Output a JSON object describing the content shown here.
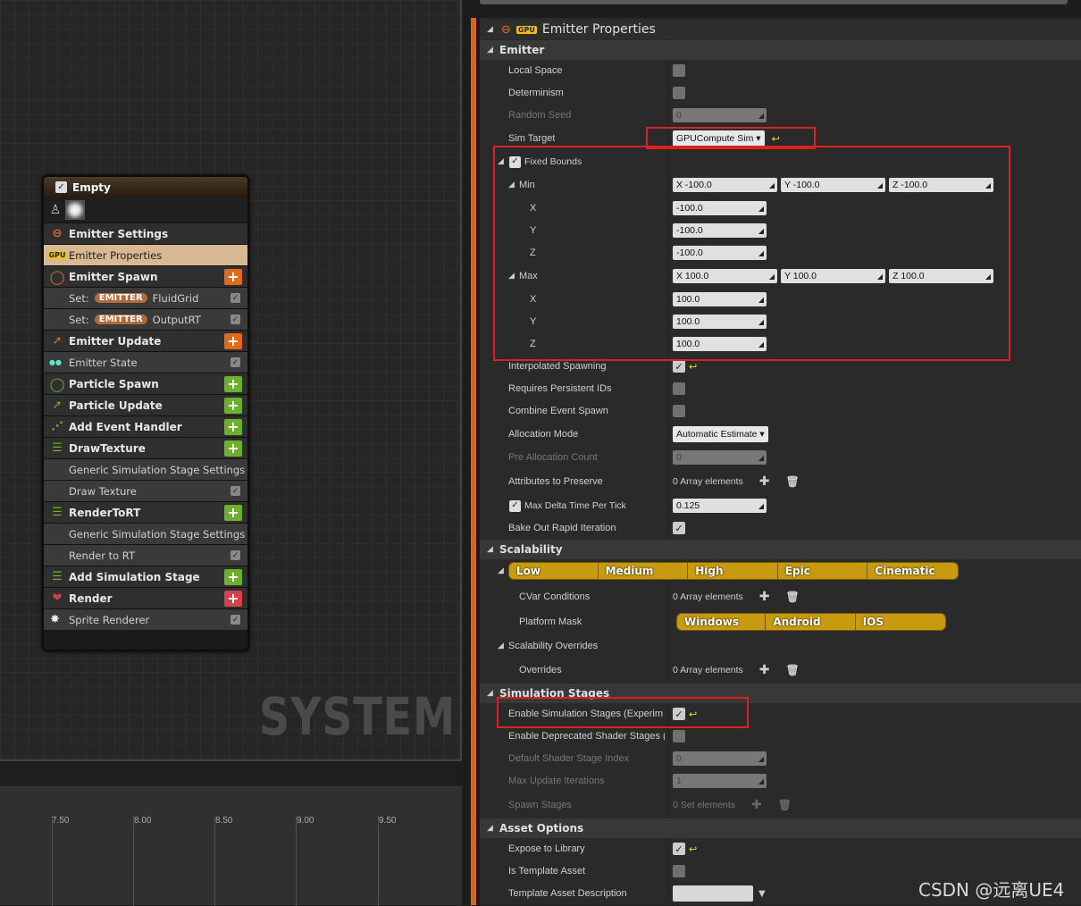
{
  "graph": {
    "watermark": "SYSTEM",
    "timeline_ticks": [
      "7.50",
      "8.00",
      "8.50",
      "9.00",
      "9.50"
    ]
  },
  "node": {
    "title": "Empty",
    "sections": {
      "emitter_settings": "Emitter Settings",
      "emitter_properties": "Emitter Properties",
      "emitter_spawn": "Emitter Spawn",
      "set1_prefix": "Set:",
      "set1_pill": "EMITTER",
      "set1_name": "FluidGrid",
      "set2_prefix": "Set:",
      "set2_pill": "EMITTER",
      "set2_name": "OutputRT",
      "emitter_update": "Emitter Update",
      "emitter_state": "Emitter State",
      "particle_spawn": "Particle Spawn",
      "particle_update": "Particle Update",
      "add_event_handler": "Add Event Handler",
      "draw_texture_stage": "DrawTexture",
      "generic_sim_settings_1": "Generic Simulation Stage Settings",
      "draw_texture": "Draw Texture",
      "render_to_rt_stage": "RenderToRT",
      "generic_sim_settings_2": "Generic Simulation Stage Settings",
      "render_to_rt": "Render to RT",
      "add_sim_stage": "Add Simulation Stage",
      "render": "Render",
      "sprite_renderer": "Sprite Renderer"
    },
    "gpu_badge": "GPU"
  },
  "details": {
    "panel_title": "Emitter Properties",
    "gpu_badge": "GPU",
    "categories": {
      "emitter": "Emitter",
      "scalability": "Scalability",
      "simulation_stages": "Simulation Stages",
      "asset_options": "Asset Options"
    },
    "props": {
      "local_space": "Local Space",
      "determinism": "Determinism",
      "random_seed": "Random Seed",
      "random_seed_val": "0",
      "sim_target": "Sim Target",
      "sim_target_val": "GPUCompute Sim",
      "fixed_bounds": "Fixed Bounds",
      "min": "Min",
      "max": "Max",
      "x": "X",
      "y": "Y",
      "z": "Z",
      "min_x": "X  -100.0",
      "min_y": "Y  -100.0",
      "min_z": "Z  -100.0",
      "min_x_val": "-100.0",
      "min_y_val": "-100.0",
      "min_z_val": "-100.0",
      "max_x": "X  100.0",
      "max_y": "Y  100.0",
      "max_z": "Z  100.0",
      "max_x_val": "100.0",
      "max_y_val": "100.0",
      "max_z_val": "100.0",
      "interpolated_spawning": "Interpolated Spawning",
      "requires_persistent_ids": "Requires Persistent IDs",
      "combine_event_spawn": "Combine Event Spawn",
      "allocation_mode": "Allocation Mode",
      "allocation_mode_val": "Automatic Estimate",
      "pre_allocation_count": "Pre Allocation Count",
      "pre_allocation_count_val": "0",
      "attributes_to_preserve": "Attributes to Preserve",
      "array_elements": "0 Array elements",
      "max_delta_time": "Max Delta Time Per Tick",
      "max_delta_time_val": "0.125",
      "bake_out": "Bake Out Rapid Iteration",
      "cvar_conditions": "CVar Conditions",
      "platform_mask": "Platform Mask",
      "scalability_overrides": "Scalability Overrides",
      "overrides": "Overrides",
      "enable_sim_stages": "Enable Simulation Stages (Experim",
      "enable_deprecated": "Enable Deprecated Shader Stages (",
      "default_shader_stage": "Default Shader Stage Index",
      "default_shader_stage_val": "0",
      "max_update_iterations": "Max Update Iterations",
      "max_update_iterations_val": "1",
      "spawn_stages": "Spawn Stages",
      "set_elements": "0 Set elements",
      "expose_to_library": "Expose to Library",
      "is_template_asset": "Is Template Asset",
      "template_asset_description": "Template Asset Description"
    },
    "quality_tabs": [
      "Low",
      "Medium",
      "High",
      "Epic",
      "Cinematic"
    ],
    "platform_tabs": [
      "Windows",
      "Android",
      "IOS"
    ]
  },
  "watermark": "CSDN @远离UE4"
}
